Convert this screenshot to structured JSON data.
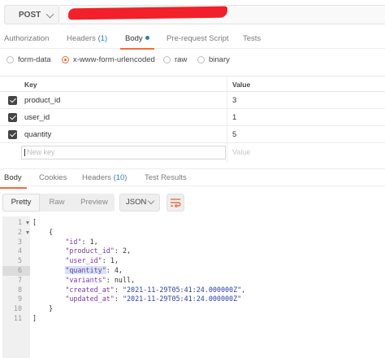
{
  "request": {
    "method": "POST",
    "tabs": [
      {
        "label": "Authorization"
      },
      {
        "label": "Headers",
        "count": "(1)"
      },
      {
        "label": "Body"
      },
      {
        "label": "Pre-request Script"
      },
      {
        "label": "Tests"
      }
    ],
    "body_types": [
      "form-data",
      "x-www-form-urlencoded",
      "raw",
      "binary"
    ],
    "selected_body_type": "x-www-form-urlencoded",
    "table": {
      "key_header": "Key",
      "value_header": "Value",
      "rows": [
        {
          "key": "product_id",
          "value": "3",
          "checked": true
        },
        {
          "key": "user_id",
          "value": "1",
          "checked": true
        },
        {
          "key": "quantity",
          "value": "5",
          "checked": true
        }
      ],
      "new_key_placeholder": "New key",
      "new_value_placeholder": "Value"
    }
  },
  "response": {
    "tabs": [
      {
        "label": "Body"
      },
      {
        "label": "Cookies"
      },
      {
        "label": "Headers",
        "count": "(10)"
      },
      {
        "label": "Test Results"
      }
    ],
    "view_modes": [
      "Pretty",
      "Raw",
      "Preview"
    ],
    "format": "JSON",
    "lines": [
      {
        "n": "1",
        "text": "["
      },
      {
        "n": "2",
        "text": "    {"
      },
      {
        "n": "3",
        "key": "\"id\"",
        "value": "1,"
      },
      {
        "n": "4",
        "key": "\"product_id\"",
        "value": "2,"
      },
      {
        "n": "5",
        "key": "\"user_id\"",
        "value": "1,"
      },
      {
        "n": "6",
        "key": "\"quantity\"",
        "value": "4,"
      },
      {
        "n": "7",
        "key": "\"variants\"",
        "value": "null,"
      },
      {
        "n": "8",
        "key": "\"created_at\"",
        "value": "\"2021-11-29T05:41:24.000000Z\","
      },
      {
        "n": "9",
        "key": "\"updated_at\"",
        "value": "\"2021-11-29T05:41:24.000000Z\""
      },
      {
        "n": "10",
        "text": "    }"
      },
      {
        "n": "11",
        "text": "]"
      }
    ]
  },
  "colors": {
    "accent": "#f26b3a",
    "link_blue": "#2f7fb6",
    "json_key": "#7b3aa8",
    "json_string": "#2c3fa5",
    "redaction": "#f2202a"
  }
}
